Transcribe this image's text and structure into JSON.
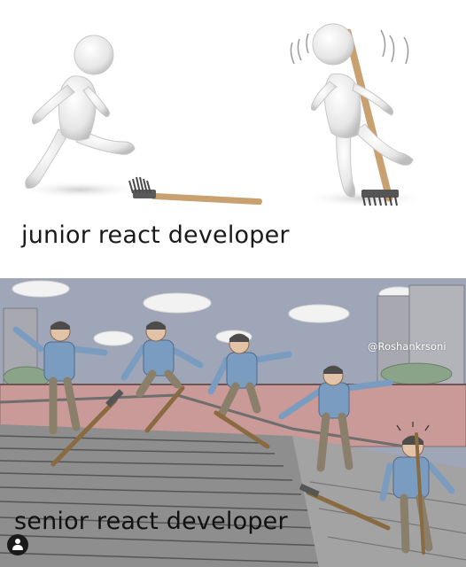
{
  "captions": {
    "top": "junior react developer",
    "bottom": "senior react developer"
  },
  "watermark": "@Roshankrsoni",
  "icons": {
    "avatar": "person-avatar-icon"
  },
  "colors": {
    "sky": "#9fa6b8",
    "wall": "#c99a97",
    "stairs": "#8e8e8e",
    "shirt": "#7a9cc0",
    "pants": "#8a7f6a",
    "rake_handle": "#c9a070"
  }
}
